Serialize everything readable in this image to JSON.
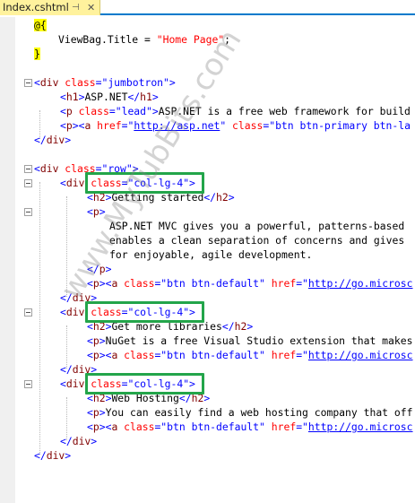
{
  "tab": {
    "filename": "Index.cshtml",
    "pin_icon": "pin-icon",
    "close_icon": "close-icon"
  },
  "code": {
    "l1_razor": "@{",
    "l2_pre": "ViewBag.Title = ",
    "l2_str": "\"Home Page\"",
    "l2_post": ";",
    "l3_razor": "}",
    "jumbotron_open": [
      "<",
      "div",
      " ",
      "class",
      "=\"",
      "jumbotron",
      "\"",
      ">"
    ],
    "h1_aspnet": "ASP.NET",
    "lead_class": "lead",
    "lead_text": "ASP.NET is a free web framework for build",
    "a_href": "http://asp.net",
    "btn_lg_class": "btn btn-primary btn-la",
    "div": "div",
    "row_class": "row",
    "col_class": "col-lg-4",
    "h2_getting_started": "Getting started",
    "p_mvc_1": "ASP.NET MVC gives you a powerful, patterns-based",
    "p_mvc_2": "enables a clean separation of concerns and gives",
    "p_mvc_3": "for enjoyable, agile development.",
    "btn_default_class": "btn btn-default",
    "href_go": "http://go.microsc",
    "h2_libraries": "Get more libraries",
    "p_nuget": "NuGet is a free Visual Studio extension that makes",
    "h2_hosting": "Web Hosting",
    "p_hosting": "You can easily find a web hosting company that off",
    "kw_class": "class",
    "kw_href": "href",
    "tag_h1": "h1",
    "tag_h2": "h2",
    "tag_p": "p",
    "tag_a": "a"
  },
  "watermark": "www.MyTubBits.com",
  "colors": {
    "tag": "#800000",
    "attr": "#ff0000",
    "value": "#0000ff",
    "razor_bg": "#ffff00",
    "highlight": "#23a54a",
    "tab_active": "#fff29d"
  }
}
